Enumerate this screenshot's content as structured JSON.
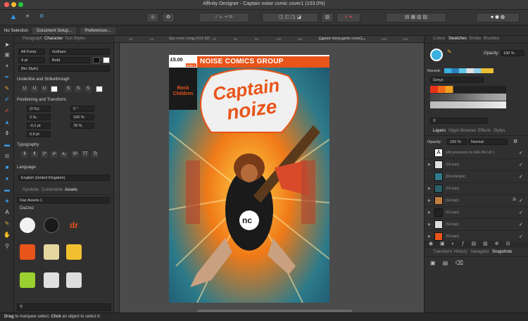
{
  "window": {
    "title": "Affinity Designer - Captain noise comic cover1 (103.0%)"
  },
  "context_bar": {
    "no_selection": "No Selection",
    "document_setup": "Document Setup...",
    "preferences": "Preferences..."
  },
  "left_panel": {
    "tabs": [
      "Paragraph",
      "Character",
      "Text Styles"
    ],
    "font_collection": "All Fonts",
    "font_family": "Gotham",
    "font_size": "4 pt",
    "font_style": "Bold",
    "style": "[No Style]",
    "underline_header": "Underline and Strikethrough",
    "position_header": "Positioning and Transform",
    "pos_values": [
      "(0 ‰)",
      "0 °",
      "2 ‰",
      "100 %",
      "-0,1 pt",
      "78 %",
      "6,6 pt"
    ],
    "typography_header": "Typography",
    "language_header": "Language",
    "language_value": "English (United Kingdom)",
    "asset_tabs": [
      "Symbols",
      "Constraints",
      "Assets"
    ],
    "asset_category": "Daz Assets 1",
    "asset_group": "Dazzez"
  },
  "canvas": {
    "ruler_labels": [
      "-40",
      "-20",
      "0",
      "20",
      "40",
      "60",
      "80",
      "100",
      "120",
      "140",
      "160",
      "180",
      "200",
      "220"
    ],
    "doc_tab_1": "Daz noise comic 2019 (M)",
    "doc_tab_2": "Captain noise comic cover1",
    "cover": {
      "price": "£5.00",
      "issue": "issue 1",
      "group": "NOISE COMICS GROUP",
      "title_line1": "Captain",
      "title_line2": "noize",
      "side_text": "Rock Children",
      "logo": "nc"
    }
  },
  "right_panel": {
    "top_tabs": [
      "Colour",
      "Swatches",
      "Stroke",
      "Brushes"
    ],
    "opacity_label": "Opacity:",
    "opacity_value": "100 %",
    "recent_label": "Recent:",
    "palette_name": "Greys",
    "layer_tabs": [
      "Layers",
      "Glyph Browser",
      "Effects",
      "Styles"
    ],
    "layer_opacity_label": "Opacity:",
    "layer_opacity_value": "100 %",
    "blend_mode": "Normal",
    "layers": [
      "(All proceeds to RALPA UK )",
      "(Group)",
      "(Rectangle)",
      "(Group)",
      "(Group)",
      "(Group)",
      "(Group)",
      "(Group)"
    ],
    "bottom_tabs": [
      "Transform",
      "History",
      "Navigator",
      "Snapshots"
    ]
  },
  "status": {
    "text_bold1": "Drag",
    "text1": " to marquee select. ",
    "text_bold2": "Click",
    "text2": " an object to select it."
  },
  "colors": {
    "accent": "#e8541a",
    "panel": "#303030",
    "canvas": "#4b4b4b"
  }
}
